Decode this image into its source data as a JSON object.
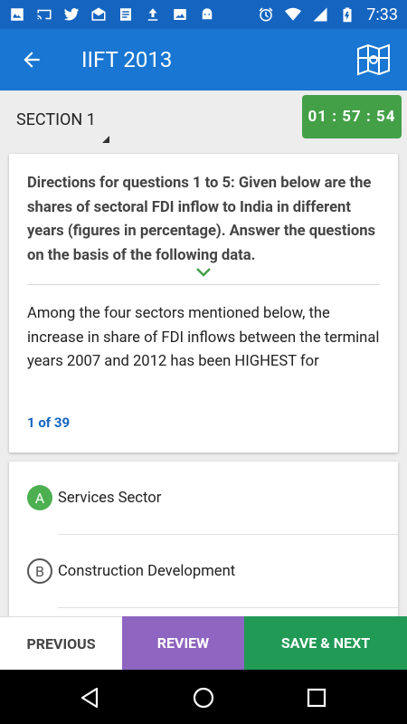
{
  "status_bar": {
    "time": "7:33"
  },
  "app_bar": {
    "title": "IIFT 2013"
  },
  "section": {
    "label": "SECTION 1"
  },
  "timer": {
    "value": "01 : 57 : 54"
  },
  "question": {
    "directions": "Directions for questions 1 to 5: Given below are the shares of sectoral FDI inflow to India in different years (figures in percentage). Answer the questions on the basis of the following data.",
    "text": "Among the four sectors mentioned below, the increase in share of FDI inflows between the terminal years 2007 and 2012 has been HIGHEST for",
    "counter": "1 of 39"
  },
  "options": [
    {
      "letter": "A",
      "text": "Services Sector",
      "selected": true
    },
    {
      "letter": "B",
      "text": "Construction Development",
      "selected": false
    }
  ],
  "buttons": {
    "previous": "PREVIOUS",
    "review": "REVIEW",
    "save_next": "SAVE & NEXT"
  },
  "colors": {
    "status_bar": "#1565c0",
    "app_bar": "#1976d2",
    "timer": "#43a047",
    "review": "#8e65c0",
    "save_next": "#219a56",
    "counter": "#1565c0"
  }
}
